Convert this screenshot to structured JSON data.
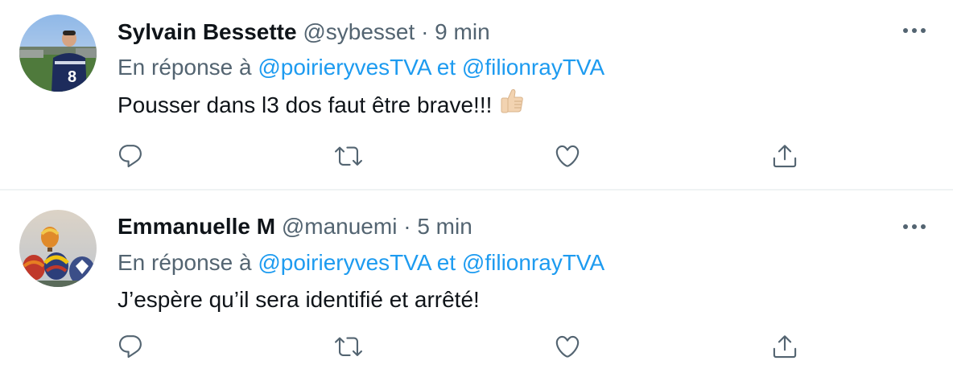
{
  "colors": {
    "accent": "#1d9bf0",
    "text_primary": "#0f1419",
    "text_secondary": "#536471",
    "divider": "#eff3f4"
  },
  "tweets": [
    {
      "author_name": "Sylvain Bessette",
      "handle": "@sybesset",
      "separator": "·",
      "time": "9 min",
      "reply_prefix": "En réponse à",
      "mention_1": "@poirieryvesTVA",
      "reply_and": "et",
      "mention_2": "@filionrayTVA",
      "text": "Pousser dans l3 dos faut être brave!!!",
      "emoji": "thumbs-up-light-skin-tone",
      "icons": [
        "more-icon",
        "reply-icon",
        "retweet-icon",
        "like-icon",
        "share-icon"
      ]
    },
    {
      "author_name": "Emmanuelle M",
      "handle": "@manuemi",
      "separator": "·",
      "time": "5 min",
      "reply_prefix": "En réponse à",
      "mention_1": "@poirieryvesTVA",
      "reply_and": "et",
      "mention_2": "@filionrayTVA",
      "text": "J’espère qu’il sera identifié et arrêté!",
      "icons": [
        "more-icon",
        "reply-icon",
        "retweet-icon",
        "like-icon",
        "share-icon"
      ]
    }
  ]
}
